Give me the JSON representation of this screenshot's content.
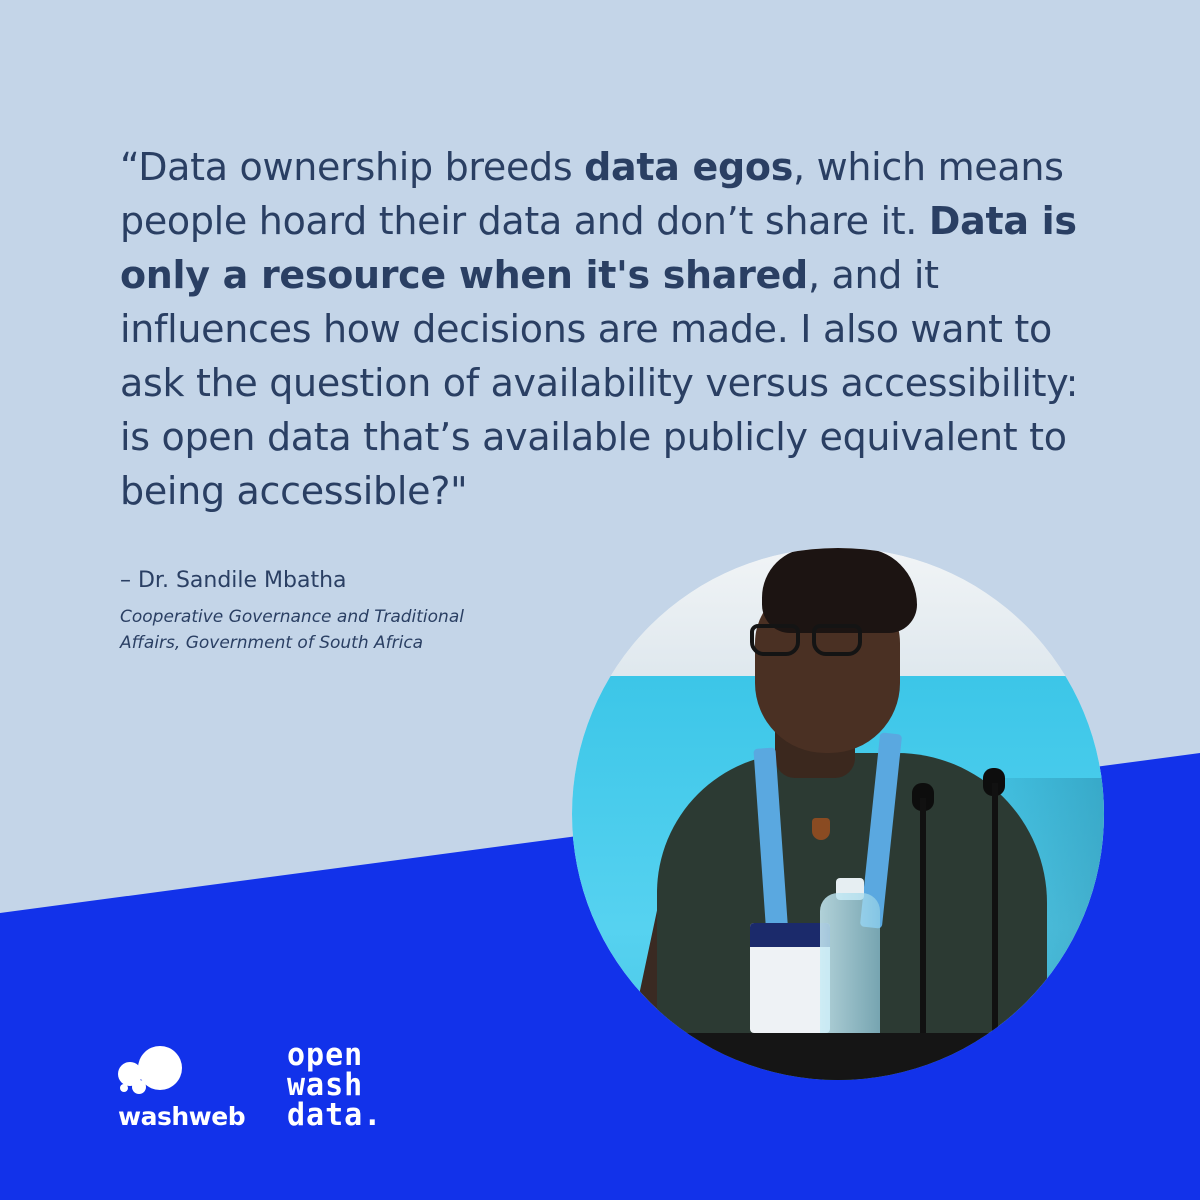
{
  "quote": {
    "open_mark": "“",
    "segments": [
      "Data ownership breeds ",
      "data egos",
      ", which means people hoard their data and don’t share it. ",
      "Data is only a resource when it's shared",
      ", and it influences how decisions are made. I also want to ask the question of availability versus accessibility: is open data that’s available publicly equivalent to being accessible?\""
    ]
  },
  "attribution": {
    "author": "– Dr. Sandile Mbatha",
    "affiliation_line1": "Cooperative Governance and Traditional",
    "affiliation_line2": "Affairs, Government of South Africa"
  },
  "logos": {
    "washweb": "washweb",
    "openwashdata": [
      "open",
      "wash",
      "data."
    ]
  },
  "colors": {
    "background": "#c4d5e8",
    "band": "#1232ea",
    "text": "#2a3f63",
    "logo": "#ffffff"
  },
  "photo": {
    "subject": "speaker-photo"
  }
}
